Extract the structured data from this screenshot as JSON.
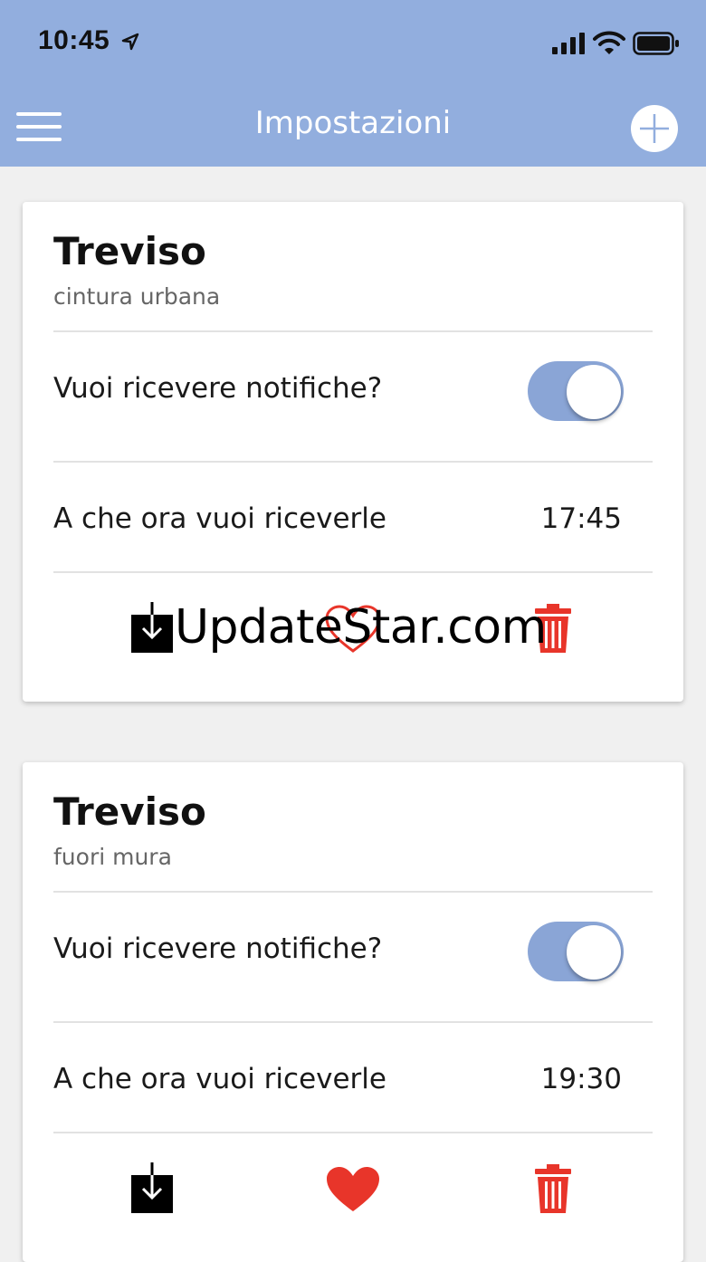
{
  "status_bar": {
    "time": "10:45",
    "icons": [
      "location-arrow-icon",
      "cellular-signal-icon",
      "wifi-icon",
      "battery-icon"
    ]
  },
  "nav": {
    "title": "Impostazioni",
    "menu_icon": "hamburger-menu-icon",
    "add_icon": "plus-circle-icon"
  },
  "colors": {
    "header": "#92aede",
    "toggle_on": "#8aa5d6",
    "heart": "#e8352a",
    "trash": "#e8352a"
  },
  "cards": [
    {
      "title": "Treviso",
      "subtitle": "cintura urbana",
      "notify_label": "Vuoi ricevere notifiche?",
      "notify_enabled": true,
      "time_label": "A che ora vuoi riceverle",
      "time_value": "17:45",
      "favorite": false,
      "watermark": "UpdateStar.com",
      "actions": [
        "download-icon",
        "heart-outline-icon",
        "trash-icon"
      ]
    },
    {
      "title": "Treviso",
      "subtitle": "fuori mura",
      "notify_label": "Vuoi ricevere notifiche?",
      "notify_enabled": true,
      "time_label": "A che ora vuoi riceverle",
      "time_value": "19:30",
      "favorite": true,
      "actions": [
        "download-icon",
        "heart-filled-icon",
        "trash-icon"
      ]
    }
  ]
}
